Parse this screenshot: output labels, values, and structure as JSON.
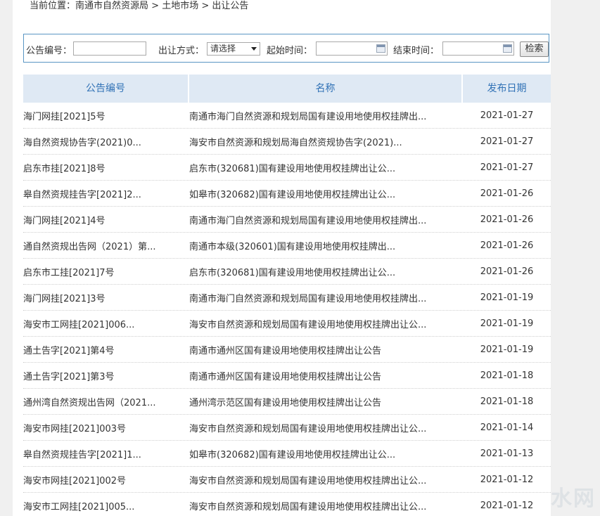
{
  "breadcrumb": {
    "prefix": "当前位置：",
    "items": [
      "南通市自然资源局",
      "土地市场",
      "出让公告"
    ],
    "separator": " > "
  },
  "search": {
    "notice_no_label": "公告编号：",
    "notice_no_value": "",
    "transfer_method_label": "出让方式：",
    "transfer_method_selected": "请选择",
    "start_time_label": "起始时间：",
    "start_time_value": "",
    "end_time_label": "结束时间：",
    "end_time_value": "",
    "search_button": "检索"
  },
  "table": {
    "columns": [
      "公告编号",
      "名称",
      "发布日期"
    ],
    "rows": [
      {
        "id": "海门网挂[2021]5号",
        "name": "南通市海门自然资源和规划局国有建设用地使用权挂牌出...",
        "date": "2021-01-27"
      },
      {
        "id": "海自然资规协告字(2021)0...",
        "name": "海安市自然资源和规划局海自然资规协告字(2021)...",
        "date": "2021-01-27"
      },
      {
        "id": "启东市挂[2021]8号",
        "name": "启东市(320681)国有建设用地使用权挂牌出让公...",
        "date": "2021-01-27"
      },
      {
        "id": "皋自然资规挂告字[2021]2...",
        "name": "如皋市(320682)国有建设用地使用权挂牌出让公...",
        "date": "2021-01-26"
      },
      {
        "id": "海门网挂[2021]4号",
        "name": "南通市海门自然资源和规划局国有建设用地使用权挂牌出...",
        "date": "2021-01-26"
      },
      {
        "id": "通自然资规出告网（2021）第...",
        "name": "南通市本级(320601)国有建设用地使用权挂牌出...",
        "date": "2021-01-26"
      },
      {
        "id": "启东市工挂[2021]7号",
        "name": "启东市(320681)国有建设用地使用权挂牌出让公...",
        "date": "2021-01-26"
      },
      {
        "id": "海门网挂[2021]3号",
        "name": "南通市海门自然资源和规划局国有建设用地使用权挂牌出...",
        "date": "2021-01-19"
      },
      {
        "id": "海安市工网挂[2021]006...",
        "name": "海安市自然资源和规划局国有建设用地使用权挂牌出让公...",
        "date": "2021-01-19"
      },
      {
        "id": "通土告字[2021]第4号",
        "name": "南通市通州区国有建设用地使用权挂牌出让公告",
        "date": "2021-01-19"
      },
      {
        "id": "通土告字[2021]第3号",
        "name": "南通市通州区国有建设用地使用权挂牌出让公告",
        "date": "2021-01-18"
      },
      {
        "id": "通州湾自然资规出告网（2021...",
        "name": "通州湾示范区国有建设用地使用权挂牌出让公告",
        "date": "2021-01-18"
      },
      {
        "id": "海安市网挂[2021]003号",
        "name": "海安市自然资源和规划局国有建设用地使用权挂牌出让公...",
        "date": "2021-01-14"
      },
      {
        "id": "皋自然资规挂告字[2021]1...",
        "name": "如皋市(320682)国有建设用地使用权挂牌出让公...",
        "date": "2021-01-13"
      },
      {
        "id": "海安市网挂[2021]002号",
        "name": "海安市自然资源和规划局国有建设用地使用权挂牌出让公...",
        "date": "2021-01-12"
      },
      {
        "id": "海安市工网挂[2021]005...",
        "name": "海安市自然资源和规划局国有建设用地使用权挂牌出让公...",
        "date": "2021-01-12"
      }
    ]
  },
  "colors": {
    "header_bg": "#dfe9f4",
    "header_text": "#3172b6",
    "search_border": "#5a96c4",
    "page_bg": "#f0f0f0"
  }
}
